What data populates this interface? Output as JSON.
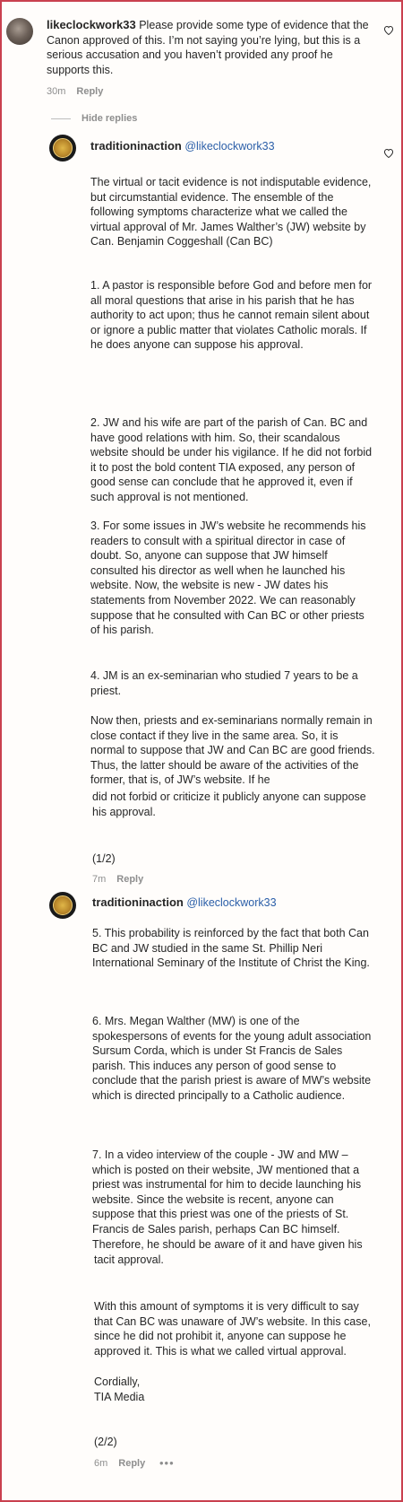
{
  "comment1": {
    "username": "likeclockwork33",
    "text": "Please provide some type of evidence that the Canon approved of this. I’m not saying you’re lying, but this is a serious accusation and you haven’t provided any proof he supports this.",
    "time": "30m",
    "reply_label": "Reply"
  },
  "hide_replies_label": "Hide replies",
  "reply1": {
    "username": "traditioninaction",
    "mention": "@likeclockwork33",
    "paragraphs": [
      "The virtual or tacit evidence is not indisputable evidence, but circumstantial evidence. The ensemble of the following symptoms characterize what we called the virtual approval of Mr. James Walther’s (JW) website by Can. Benjamin Coggeshall (Can BC)",
      "1. A pastor is responsible before God and before men for all moral questions that arise in his parish that he has authority to act upon; thus he cannot remain silent about or ignore a public matter that violates Catholic morals. If he does anyone can suppose his approval.",
      "2. JW and his wife are part of the parish of Can. BC and have good relations with him. So, their scandalous website should be under his vigilance. If he did not forbid it to post the bold content TIA exposed, any person of good sense can conclude that he approved it, even if such approval is not mentioned.",
      "3. For some issues in JW’s website he recommends his readers to consult with a spiritual director in case of doubt. So, anyone can suppose that JW himself consulted his director as well when he launched his website. Now, the website is new - JW dates his statements from November 2022. We can reasonably suppose that he consulted with Can BC or other priests of his parish.",
      "4. JM is an ex-seminarian who studied 7 years to be a priest.",
      "Now then, priests and ex-seminarians normally remain in close contact if they live in the same area. So, it is normal to suppose that JW and Can BC are good friends. Thus, the latter should be aware of the activities of the former, that is, of JW’s website. If he",
      "did not forbid or criticize it publicly anyone can suppose his approval.",
      "(1/2)"
    ],
    "time": "7m",
    "reply_label": "Reply"
  },
  "reply2": {
    "username": "traditioninaction",
    "mention": "@likeclockwork33",
    "paragraphs": [
      "5. This probability is reinforced by the fact that both Can BC and JW studied in the same St. Phillip Neri International Seminary of the Institute of Christ the King.",
      "6. Mrs. Megan Walther (MW) is one of the spokespersons of events for the young adult association Sursum Corda, which is under St Francis de Sales parish. This induces any person of good sense to conclude that the parish priest is aware of MW’s website which is directed principally to a Catholic audience.",
      "7. In a video interview of the couple - JW and MW – which is posted on their website, JW mentioned that a priest was instrumental for him to decide launching his website. Since the website is recent, anyone can suppose that this priest was one of the priests of St. Francis de Sales parish, perhaps Can BC himself. Therefore, he should be aware of it and have given his",
      "tacit approval.",
      "With this amount of symptoms it is very difficult to say that Can BC was unaware of JW’s website. In this case, since he did not prohibit it, anyone can suppose he approved it. This is what we called virtual approval.",
      "Cordially,\nTIA Media",
      "(2/2)"
    ],
    "time": "6m",
    "reply_label": "Reply",
    "more_label": "•••"
  },
  "icons": {
    "like": "heart-icon",
    "more": "more-options-icon"
  },
  "colors": {
    "frame_border": "#c9404f",
    "mention": "#2a5ea8",
    "meta": "#8e8e8e"
  }
}
